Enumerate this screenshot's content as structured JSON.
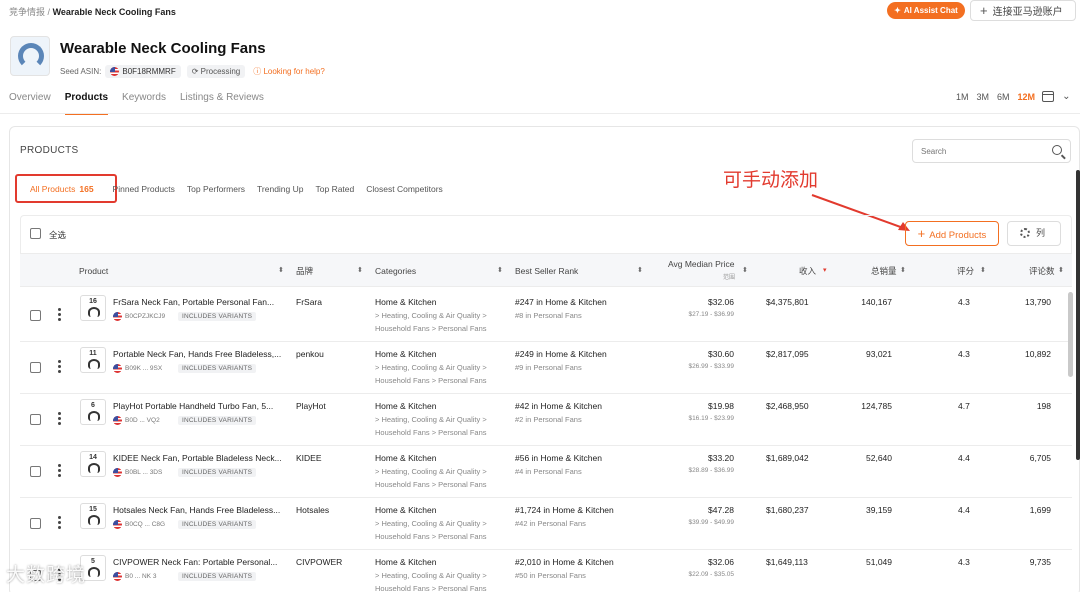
{
  "breadcrumb": {
    "parent": "竞争情报",
    "sep": "/",
    "current": "Wearable Neck Cooling Fans"
  },
  "header": {
    "ai_button": "AI Assist Chat",
    "connect_button": "连接亚马逊账户",
    "title": "Wearable Neck Cooling Fans",
    "seed_label": "Seed ASIN:",
    "seed_asin": "B0F18RMMRF",
    "status": "Processing",
    "help": "Looking for help?"
  },
  "tabs": [
    "Overview",
    "Products",
    "Keywords",
    "Listings & Reviews"
  ],
  "active_tab": "Products",
  "ranges": [
    "1M",
    "3M",
    "6M",
    "12M"
  ],
  "active_range": "12M",
  "section": {
    "title": "PRODUCTS",
    "search_placeholder": "Search",
    "subtabs": [
      "Pinned Products",
      "Top Performers",
      "Trending Up",
      "Top Rated",
      "Closest Competitors"
    ],
    "all_label": "All Products",
    "all_count": "165"
  },
  "annotation": "可手动添加",
  "toolbar": {
    "select_all": "全选",
    "add_button": "Add Products",
    "columns_button": "列"
  },
  "columns": {
    "product": "Product",
    "brand": "品牌",
    "categories": "Categories",
    "bsr": "Best Seller Rank",
    "price": "Avg Median Price",
    "price_sub": "范围",
    "revenue": "收入",
    "sales": "总销量",
    "rating": "评分",
    "reviews": "评论数"
  },
  "rows": [
    {
      "num": "16",
      "title": "FrSara Neck Fan, Portable Personal Fan...",
      "asin": "B0CPZJKCJ9",
      "variant": "INCLUDES VARIANTS",
      "brand": "FrSara",
      "cat1": "Home & Kitchen",
      "cat2": "> Heating, Cooling & Air Quality >",
      "cat3": "Household Fans > Personal Fans",
      "bsr1": "#247 in Home & Kitchen",
      "bsr2": "#8 in Personal Fans",
      "price": "$32.06",
      "range": "$27.19 - $36.99",
      "revenue": "$4,375,801",
      "sales": "140,167",
      "rating": "4.3",
      "reviews": "13,790"
    },
    {
      "num": "11",
      "title": "Portable Neck Fan, Hands Free Bladeless,...",
      "asin": "B09K ... 9SX",
      "variant": "INCLUDES VARIANTS",
      "brand": "penkou",
      "cat1": "Home & Kitchen",
      "cat2": "> Heating, Cooling & Air Quality >",
      "cat3": "Household Fans > Personal Fans",
      "bsr1": "#249 in Home & Kitchen",
      "bsr2": "#9 in Personal Fans",
      "price": "$30.60",
      "range": "$26.99 - $33.99",
      "revenue": "$2,817,095",
      "sales": "93,021",
      "rating": "4.3",
      "reviews": "10,892"
    },
    {
      "num": "6",
      "title": "PlayHot Portable Handheld Turbo Fan, 5...",
      "asin": "B0D ... VQ2",
      "variant": "INCLUDES VARIANTS",
      "brand": "PlayHot",
      "cat1": "Home & Kitchen",
      "cat2": "> Heating, Cooling & Air Quality >",
      "cat3": "Household Fans > Personal Fans",
      "bsr1": "#42 in Home & Kitchen",
      "bsr2": "#2 in Personal Fans",
      "price": "$19.98",
      "range": "$16.19 - $23.99",
      "revenue": "$2,468,950",
      "sales": "124,785",
      "rating": "4.7",
      "reviews": "198"
    },
    {
      "num": "14",
      "title": "KIDEE Neck Fan, Portable Bladeless Neck...",
      "asin": "B0BL ... 3DS",
      "variant": "INCLUDES VARIANTS",
      "brand": "KIDEE",
      "cat1": "Home & Kitchen",
      "cat2": "> Heating, Cooling & Air Quality >",
      "cat3": "Household Fans > Personal Fans",
      "bsr1": "#56 in Home & Kitchen",
      "bsr2": "#4 in Personal Fans",
      "price": "$33.20",
      "range": "$28.89 - $36.99",
      "revenue": "$1,689,042",
      "sales": "52,640",
      "rating": "4.4",
      "reviews": "6,705"
    },
    {
      "num": "15",
      "title": "Hotsales Neck Fan, Hands Free Bladeless...",
      "asin": "B0CQ ... C8G",
      "variant": "INCLUDES VARIANTS",
      "brand": "Hotsales",
      "cat1": "Home & Kitchen",
      "cat2": "> Heating, Cooling & Air Quality >",
      "cat3": "Household Fans > Personal Fans",
      "bsr1": "#1,724 in Home & Kitchen",
      "bsr2": "#42 in Personal Fans",
      "price": "$47.28",
      "range": "$39.99 - $49.99",
      "revenue": "$1,680,237",
      "sales": "39,159",
      "rating": "4.4",
      "reviews": "1,699"
    },
    {
      "num": "5",
      "title": "CIVPOWER Neck Fan: Portable Personal...",
      "asin": "B0 ... NK 3",
      "variant": "INCLUDES VARIANTS",
      "brand": "CIVPOWER",
      "cat1": "Home & Kitchen",
      "cat2": "> Heating, Cooling & Air Quality >",
      "cat3": "Household Fans > Personal Fans",
      "bsr1": "#2,010 in Home & Kitchen",
      "bsr2": "#50 in Personal Fans",
      "price": "$32.06",
      "range": "$22.09 - $35.05",
      "revenue": "$1,649,113",
      "sales": "51,049",
      "rating": "4.3",
      "reviews": "9,735"
    }
  ],
  "watermark": "大数跨境",
  "colors": {
    "accent": "#f36f21",
    "annotation": "#e23a2e"
  }
}
